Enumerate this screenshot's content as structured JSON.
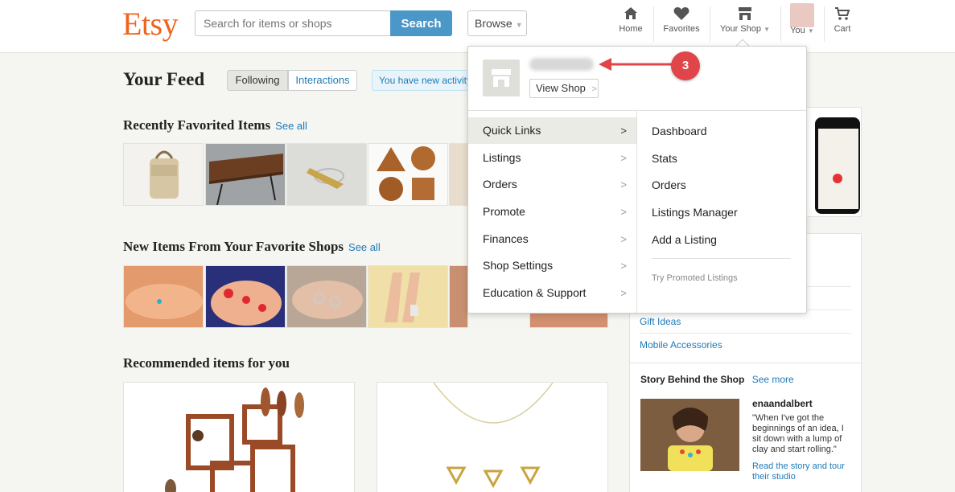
{
  "header": {
    "logo": "Etsy",
    "search_placeholder": "Search for items or shops",
    "search_button": "Search",
    "browse": "Browse",
    "nav": {
      "home": "Home",
      "favorites": "Favorites",
      "your_shop": "Your Shop",
      "you": "You",
      "cart": "Cart"
    }
  },
  "feed": {
    "title": "Your Feed",
    "tabs": [
      "Following",
      "Interactions"
    ],
    "activity_notice": "You have new activity!"
  },
  "sections": {
    "recently_favorited": "Recently Favorited Items",
    "new_items": "New Items From Your Favorite Shops",
    "recommended": "Recommended items for you",
    "see_all": "See all"
  },
  "dropdown": {
    "view_shop": "View Shop",
    "callout_number": "3",
    "left_menu": [
      "Quick Links",
      "Listings",
      "Orders",
      "Promote",
      "Finances",
      "Shop Settings",
      "Education & Support"
    ],
    "right_menu": [
      "Dashboard",
      "Stats",
      "Orders",
      "Listings Manager",
      "Add a Listing"
    ],
    "try_promoted": "Try Promoted Listings"
  },
  "sidebar": {
    "categories": [
      "Gift Ideas",
      "Mobile Accessories"
    ],
    "story": {
      "heading": "Story Behind the Shop",
      "see_more": "See more",
      "shop_name": "enaandalbert",
      "quote": "\"When I've got the beginnings of an idea, I sit down with a lump of clay and start rolling.\"",
      "read_link": "Read the story and tour their studio"
    }
  },
  "colors": {
    "brand": "#f1641e",
    "link": "#1e7ab8",
    "search_button": "#4a97c8",
    "callout": "#e0454a"
  }
}
